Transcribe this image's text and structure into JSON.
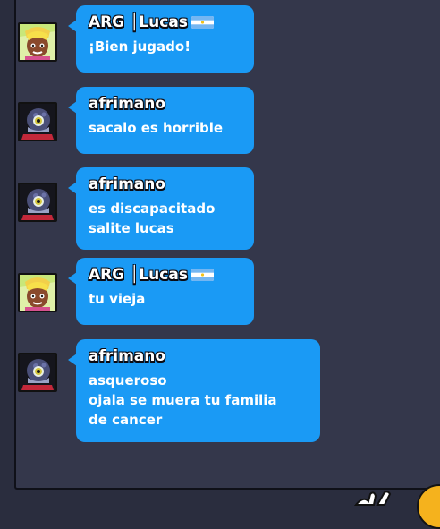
{
  "chat": {
    "messages": [
      {
        "author": "ARG │Lucas",
        "flag": "argentina-flag-icon",
        "avatar": "lucas-avatar",
        "lines": [
          "¡Bien jugado!"
        ]
      },
      {
        "author": "afrimano",
        "avatar": "afrimano-avatar",
        "lines": [
          "sacalo es horrible"
        ]
      },
      {
        "author": "afrimano",
        "avatar": "afrimano-avatar",
        "lines": [
          "es discapacitado",
          "salite lucas"
        ]
      },
      {
        "author": "ARG │Lucas",
        "flag": "argentina-flag-icon",
        "avatar": "lucas-avatar",
        "lines": [
          "tu vieja"
        ]
      },
      {
        "author": "afrimano",
        "avatar": "afrimano-avatar",
        "lines": [
          "asqueroso",
          "ojala se muera tu familia",
          "de cancer"
        ]
      }
    ]
  },
  "colors": {
    "background": "#2a2d3e",
    "panel": "#34374b",
    "bubble": "#1a9af5",
    "accent_button": "#f5b21d"
  },
  "icons": {
    "bottom_bar": [
      "hand-wave-icon",
      "action-button-icon"
    ]
  }
}
